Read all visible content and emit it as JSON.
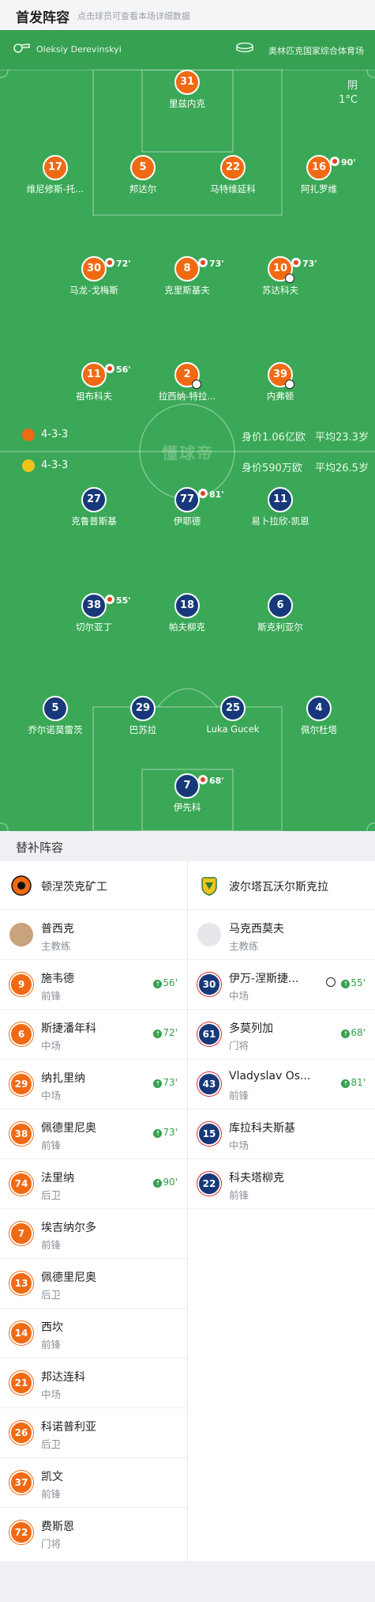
{
  "header": {
    "title": "首发阵容",
    "subtitle": "点击球员可查看本场详细数据"
  },
  "match": {
    "referee": "Oleksiy Derevinskyi",
    "venue": "奥林匹克国家综合体育场",
    "weather": "阴",
    "temperature": "1°C"
  },
  "watermark": "懂球帝",
  "home_team": {
    "name": "顿涅茨克矿工",
    "formation": "4-3-3",
    "value": "身价1.06亿欧",
    "avg_age": "平均23.3岁",
    "color": "#f06a14"
  },
  "away_team": {
    "name": "波尔塔瓦沃尔斯克拉",
    "formation": "4-3-3",
    "value": "身价590万欧",
    "avg_age": "平均26.5岁",
    "color": "#17397a"
  },
  "home_lineup": [
    {
      "number": "31",
      "name": "里兹内克"
    },
    {
      "number": "17",
      "name": "维尼修斯-托..."
    },
    {
      "number": "5",
      "name": "邦达尔"
    },
    {
      "number": "22",
      "name": "马特维延科"
    },
    {
      "number": "16",
      "name": "阿扎罗维",
      "sub_minute": "90'"
    },
    {
      "number": "30",
      "name": "马龙-戈梅斯",
      "sub_minute": "72'"
    },
    {
      "number": "8",
      "name": "克里斯基夫",
      "sub_minute": "73'"
    },
    {
      "number": "10",
      "name": "苏达科夫",
      "sub_minute": "73'"
    },
    {
      "number": "11",
      "name": "祖布科夫",
      "sub_minute": "56'"
    },
    {
      "number": "2",
      "name": "拉西纳-特拉..."
    },
    {
      "number": "39",
      "name": "内弗顿"
    }
  ],
  "away_lineup": [
    {
      "number": "27",
      "name": "克鲁普斯基"
    },
    {
      "number": "77",
      "name": "伊耶德",
      "sub_minute": "81'"
    },
    {
      "number": "11",
      "name": "易卜拉欣-凯恩"
    },
    {
      "number": "38",
      "name": "切尔亚丁",
      "sub_minute": "55'"
    },
    {
      "number": "18",
      "name": "帕夫柳克"
    },
    {
      "number": "6",
      "name": "斯克利亚尔"
    },
    {
      "number": "5",
      "name": "乔尔诺莫雷茨"
    },
    {
      "number": "29",
      "name": "巴苏拉"
    },
    {
      "number": "25",
      "name": "Luka Gucek"
    },
    {
      "number": "4",
      "name": "佩尔杜塔"
    },
    {
      "number": "7",
      "name": "伊先科",
      "sub_minute": "68'"
    }
  ],
  "subs_header": "替补阵容",
  "home_bench": {
    "coach": {
      "name": "普西克",
      "role": "主教练"
    },
    "players": [
      {
        "number": "9",
        "name": "施韦德",
        "position": "前锋",
        "in": "56'"
      },
      {
        "number": "6",
        "name": "斯捷潘年科",
        "position": "中场",
        "in": "72'"
      },
      {
        "number": "29",
        "name": "纳扎里纳",
        "position": "中场",
        "in": "73'"
      },
      {
        "number": "38",
        "name": "佩德里尼奥",
        "position": "前锋",
        "in": "73'"
      },
      {
        "number": "74",
        "name": "法里纳",
        "position": "后卫",
        "in": "90'"
      },
      {
        "number": "7",
        "name": "埃吉纳尔多",
        "position": "前锋"
      },
      {
        "number": "13",
        "name": "佩德里尼奥",
        "position": "后卫"
      },
      {
        "number": "14",
        "name": "西坎",
        "position": "前锋"
      },
      {
        "number": "21",
        "name": "邦达连科",
        "position": "中场"
      },
      {
        "number": "26",
        "name": "科诺普利亚",
        "position": "后卫"
      },
      {
        "number": "37",
        "name": "凯文",
        "position": "前锋"
      },
      {
        "number": "72",
        "name": "费斯恩",
        "position": "门将"
      }
    ]
  },
  "away_bench": {
    "coach": {
      "name": "马克西莫夫",
      "role": "主教练"
    },
    "players": [
      {
        "number": "30",
        "name": "伊万-涅斯捷...",
        "position": "中场",
        "in": "55'"
      },
      {
        "number": "61",
        "name": "多莫列加",
        "position": "门将",
        "in": "68'"
      },
      {
        "number": "43",
        "name": "Vladyslav Os...",
        "position": "前锋",
        "in": "81'"
      },
      {
        "number": "15",
        "name": "库拉科夫斯基",
        "position": "中场"
      },
      {
        "number": "22",
        "name": "科夫塔柳克",
        "position": "前锋"
      }
    ]
  },
  "icons": {
    "whistle": "whistle-icon",
    "stadium": "stadium-icon",
    "sub_off": "sub-off-icon",
    "sub_in": "sub-in-arrow-icon",
    "goal": "football-icon"
  },
  "colors": {
    "pitch": "#3aa856",
    "home": "#f06a14",
    "away": "#17397a",
    "sub_in": "#35a04e"
  }
}
